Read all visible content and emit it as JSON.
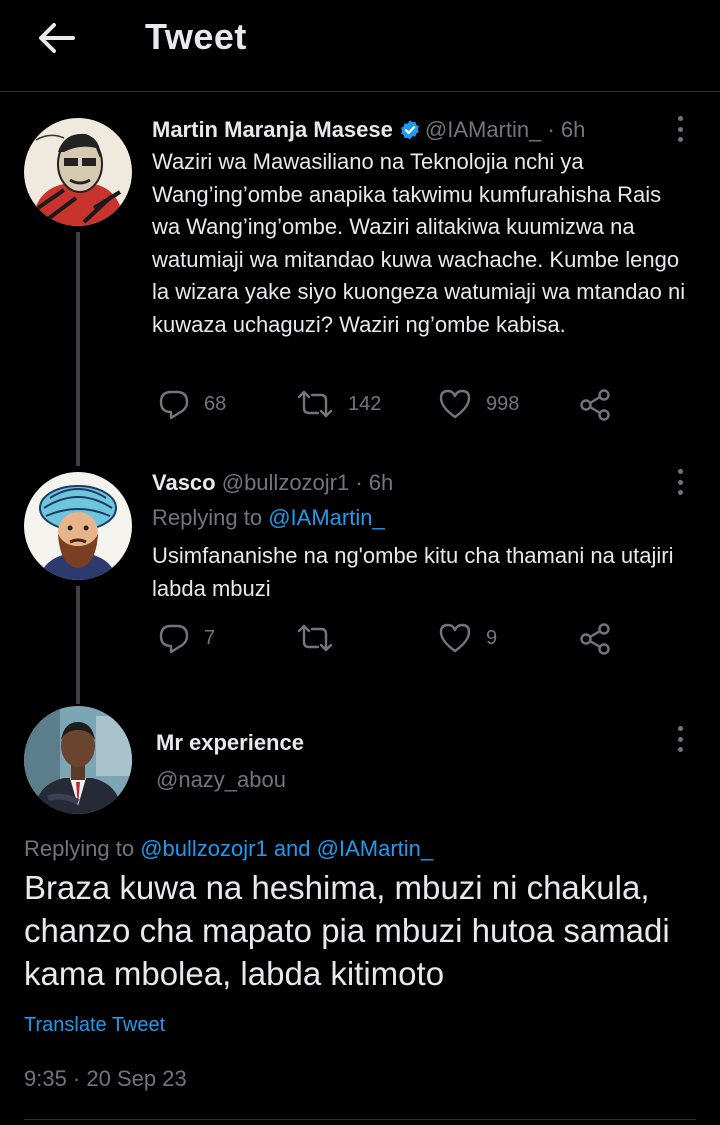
{
  "header": {
    "title": "Tweet"
  },
  "tweet1": {
    "name": "Martin Maranja Masese",
    "handle": "@IAMartin_",
    "time": "· 6h",
    "text": "Waziri wa Mawasiliano na Teknolojia nchi ya Wang’ing’ombe anapika takwimu kumfurahisha Rais wa Wang’ing’ombe. Waziri alitakiwa kuumizwa na watumiaji wa mitandao kuwa wachache. Kumbe lengo la wizara yake siyo kuongeza watumiaji wa mtandao ni kuwaza uchaguzi? Waziri ng’ombe kabisa.",
    "replies": "68",
    "retweets": "142",
    "likes": "998"
  },
  "tweet2": {
    "name": "Vasco",
    "handle": "@bullzozojr1",
    "time": "· 6h",
    "replying_prefix": "Replying to",
    "replying_to": "@IAMartin_",
    "text": "Usimfananishe na ng'ombe kitu cha thamani na utajiri labda mbuzi",
    "replies": "7",
    "retweets": "",
    "likes": "9"
  },
  "main_tweet": {
    "name": "Mr experience",
    "handle": "@nazy_abou",
    "replying_prefix": "Replying to",
    "replying_to": "@bullzozojr1 and @IAMartin_",
    "text": "Braza kuwa na heshima, mbuzi ni chakula, chanzo cha mapato pia mbuzi hutoa samadi kama mbolea, labda kitimoto",
    "translate": "Translate Tweet",
    "timestamp": "9:35 · 20 Sep 23"
  },
  "icons": {
    "back": "arrow-left-icon",
    "verified": "verified-badge-icon",
    "more": "more-vertical-icon",
    "reply": "reply-icon",
    "retweet": "retweet-icon",
    "like": "heart-icon",
    "share": "share-icon"
  },
  "colors": {
    "background": "#000000",
    "text": "#e7e9ea",
    "muted": "#71767b",
    "link": "#1d9bf0",
    "divider": "#2f3336"
  }
}
